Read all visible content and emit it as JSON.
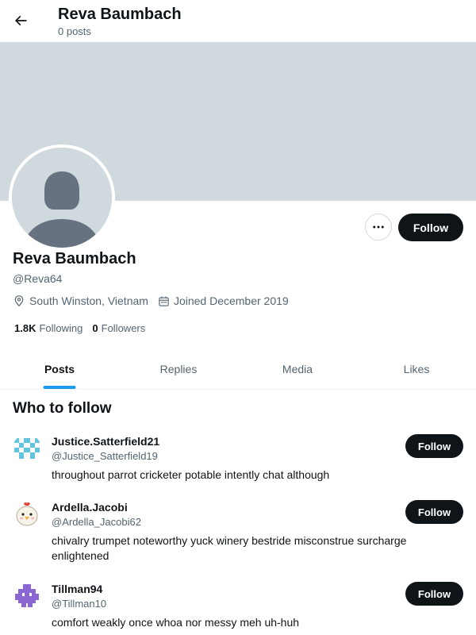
{
  "header": {
    "back_icon": "arrow-left-icon",
    "title": "Reva Baumbach",
    "subtitle": "0 posts"
  },
  "profile": {
    "name": "Reva Baumbach",
    "handle": "@Reva64",
    "location": "South Winston, Vietnam",
    "joined": "Joined December 2019",
    "following_count": "1.8K",
    "following_label": "Following",
    "followers_count": "0",
    "followers_label": "Followers",
    "follow_label": "Follow",
    "more_icon": "more-horizontal-icon",
    "banner_color": "#cfd9de"
  },
  "tabs": [
    {
      "label": "Posts",
      "active": true
    },
    {
      "label": "Replies",
      "active": false
    },
    {
      "label": "Media",
      "active": false
    },
    {
      "label": "Likes",
      "active": false
    }
  ],
  "who_to_follow": {
    "title": "Who to follow",
    "users": [
      {
        "name": "Justice.Satterfield21",
        "handle": "@Justice_Satterfield19",
        "bio": "throughout parrot cricketer potable intently chat although",
        "follow_label": "Follow"
      },
      {
        "name": "Ardella.Jacobi",
        "handle": "@Ardella_Jacobi62",
        "bio": "chivalry trumpet noteworthy yuck winery bestride misconstrue surcharge enlightened",
        "follow_label": "Follow"
      },
      {
        "name": "Tillman94",
        "handle": "@Tillman10",
        "bio": "comfort weakly once whoa nor messy meh uh-huh",
        "follow_label": "Follow"
      }
    ]
  },
  "colors": {
    "accent": "#1d9bf0",
    "text_primary": "#0f1419",
    "text_secondary": "#536471"
  }
}
